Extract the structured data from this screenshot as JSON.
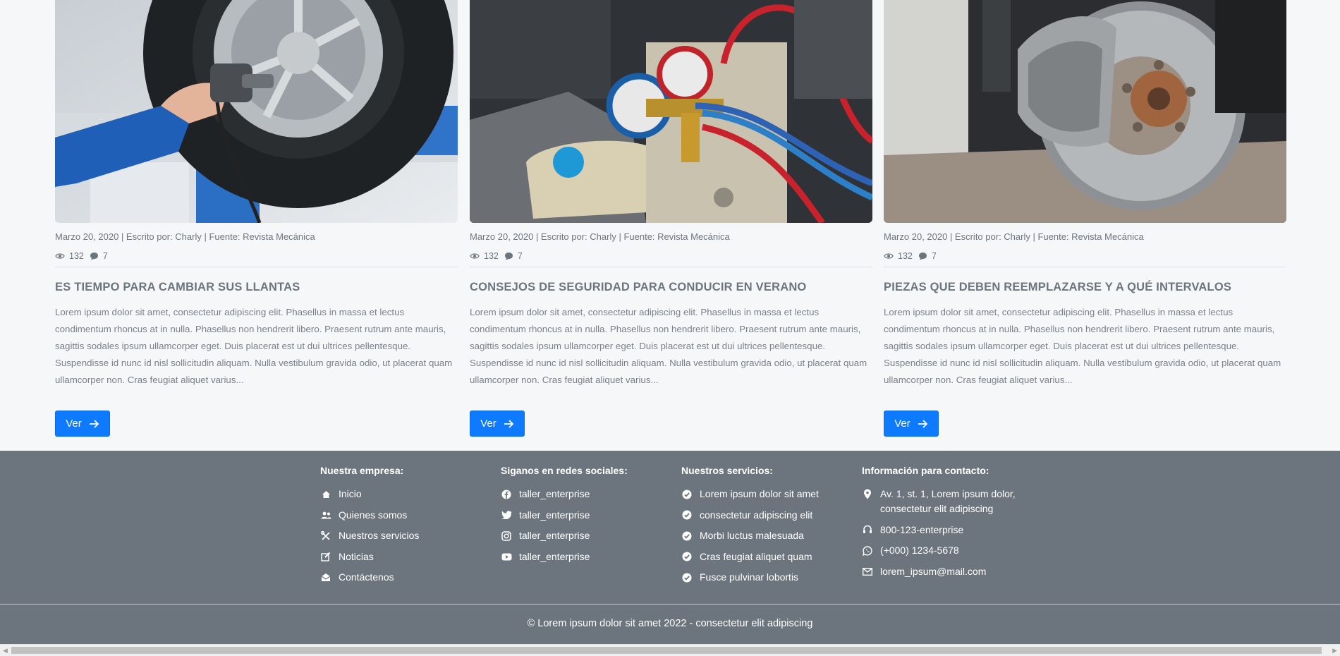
{
  "colors": {
    "page_bg": "#f6f7f9",
    "footer_bg": "#6c757d",
    "button_bg": "#0d7aff",
    "text_muted": "#6c757d"
  },
  "articles": [
    {
      "image_alt": "mechanic-changing-tire-image",
      "meta": "Marzo 20, 2020 | Escrito por: Charly | Fuente: Revista Mecánica",
      "views": "132",
      "comments": "7",
      "title": "ES TIEMPO PARA CAMBIAR SUS LLANTAS",
      "excerpt": "Lorem ipsum dolor sit amet, consectetur adipiscing elit. Phasellus in massa et lectus condimentum rhoncus at in nulla. Phasellus non hendrerit libero. Praesent rutrum ante mauris, sagittis sodales ipsum ullamcorper eget. Duis placerat est ut dui ultrices pellentesque. Suspendisse id nunc id nisl sollicitudin aliquam. Nulla vestibulum gravida odio, ut placerat quam ullamcorper non. Cras feugiat aliquet varius...",
      "button_label": "Ver"
    },
    {
      "image_alt": "ac-gauges-engine-image",
      "meta": "Marzo 20, 2020 | Escrito por: Charly | Fuente: Revista Mecánica",
      "views": "132",
      "comments": "7",
      "title": "CONSEJOS DE SEGURIDAD PARA CONDUCIR EN VERANO",
      "excerpt": "Lorem ipsum dolor sit amet, consectetur adipiscing elit. Phasellus in massa et lectus condimentum rhoncus at in nulla. Phasellus non hendrerit libero. Praesent rutrum ante mauris, sagittis sodales ipsum ullamcorper eget. Duis placerat est ut dui ultrices pellentesque. Suspendisse id nunc id nisl sollicitudin aliquam. Nulla vestibulum gravida odio, ut placerat quam ullamcorper non. Cras feugiat aliquet varius...",
      "button_label": "Ver"
    },
    {
      "image_alt": "brake-disc-caliper-image",
      "meta": "Marzo 20, 2020 | Escrito por: Charly | Fuente: Revista Mecánica",
      "views": "132",
      "comments": "7",
      "title": "PIEZAS QUE DEBEN REEMPLAZARSE Y A QUÉ INTERVALOS",
      "excerpt": "Lorem ipsum dolor sit amet, consectetur adipiscing elit. Phasellus in massa et lectus condimentum rhoncus at in nulla. Phasellus non hendrerit libero. Praesent rutrum ante mauris, sagittis sodales ipsum ullamcorper eget. Duis placerat est ut dui ultrices pellentesque. Suspendisse id nunc id nisl sollicitudin aliquam. Nulla vestibulum gravida odio, ut placerat quam ullamcorper non. Cras feugiat aliquet varius...",
      "button_label": "Ver"
    }
  ],
  "footer": {
    "company": {
      "heading": "Nuestra empresa:",
      "items": [
        {
          "label": "Inicio",
          "icon": "home-icon"
        },
        {
          "label": "Quienes somos",
          "icon": "users-icon"
        },
        {
          "label": "Nuestros servicios",
          "icon": "tools-icon"
        },
        {
          "label": "Noticias",
          "icon": "edit-icon"
        },
        {
          "label": "Contáctenos",
          "icon": "envelope-open-icon"
        }
      ]
    },
    "social": {
      "heading": "Siganos en redes sociales:",
      "items": [
        {
          "label": "taller_enterprise",
          "icon": "facebook-icon"
        },
        {
          "label": "taller_enterprise",
          "icon": "twitter-icon"
        },
        {
          "label": "taller_enterprise",
          "icon": "instagram-icon"
        },
        {
          "label": "taller_enterprise",
          "icon": "youtube-icon"
        }
      ]
    },
    "services": {
      "heading": "Nuestros servicios:",
      "items": [
        {
          "label": "Lorem ipsum dolor sit amet",
          "icon": "check-circle-icon"
        },
        {
          "label": "consectetur adipiscing elit",
          "icon": "check-circle-icon"
        },
        {
          "label": "Morbi luctus malesuada",
          "icon": "check-circle-icon"
        },
        {
          "label": "Cras feugiat aliquet quam",
          "icon": "check-circle-icon"
        },
        {
          "label": "Fusce pulvinar lobortis",
          "icon": "check-circle-icon"
        }
      ]
    },
    "contact": {
      "heading": "Información para contacto:",
      "items": [
        {
          "label": "Av. 1, st. 1, Lorem ipsum dolor, consectetur elit adipiscing",
          "icon": "map-pin-icon"
        },
        {
          "label": "800-123-enterprise",
          "icon": "headset-icon"
        },
        {
          "label": "(+000) 1234-5678",
          "icon": "whatsapp-icon"
        },
        {
          "label": "lorem_ipsum@mail.com",
          "icon": "mail-icon"
        }
      ]
    },
    "copyright": "© Lorem ipsum dolor sit amet 2022 - consectetur elit adipiscing"
  }
}
